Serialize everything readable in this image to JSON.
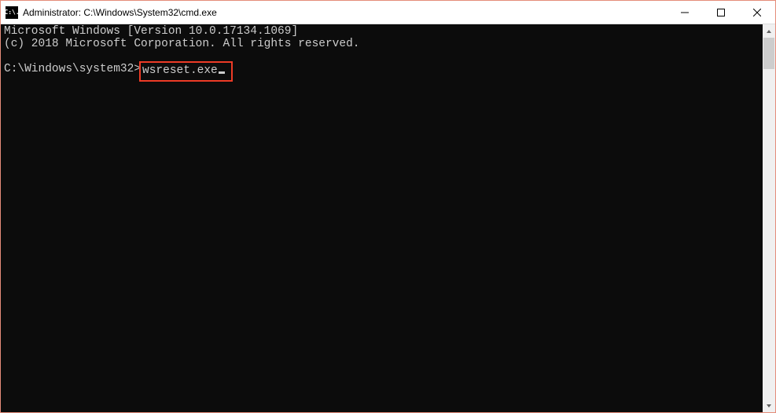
{
  "titlebar": {
    "icon_text": "C:\\.",
    "title": "Administrator: C:\\Windows\\System32\\cmd.exe"
  },
  "terminal": {
    "line1": "Microsoft Windows [Version 10.0.17134.1069]",
    "line2": "(c) 2018 Microsoft Corporation. All rights reserved.",
    "prompt": "C:\\Windows\\system32>",
    "command": "wsreset.exe"
  }
}
